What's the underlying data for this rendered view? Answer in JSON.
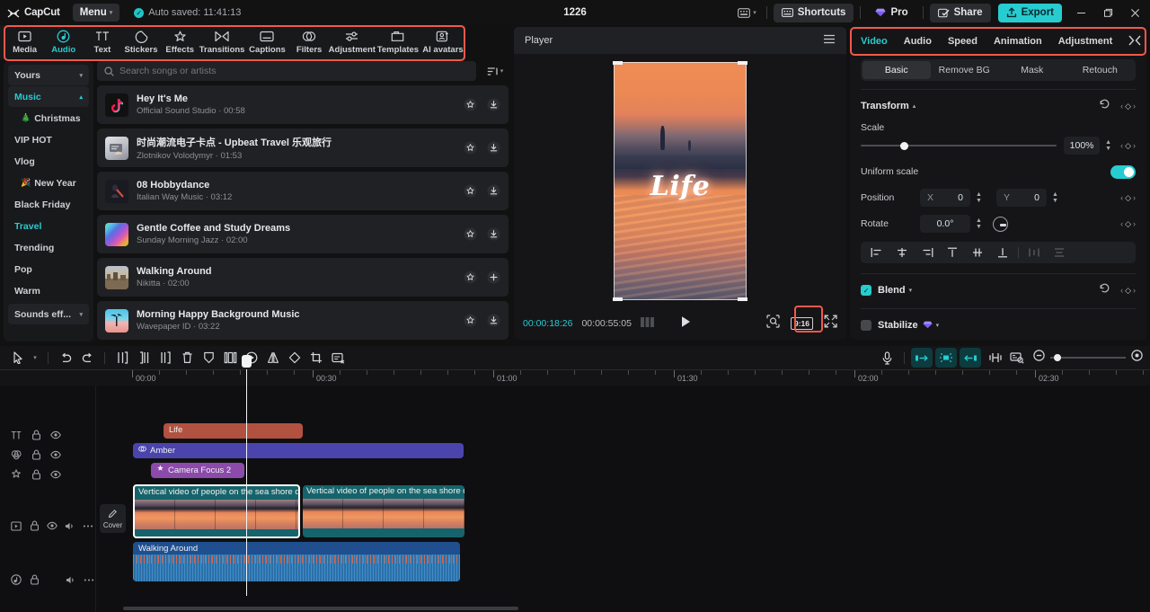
{
  "titlebar": {
    "brand": "CapCut",
    "menu_label": "Menu",
    "autosave_text": "Auto saved: 11:41:13",
    "project_title": "1226",
    "shortcuts_label": "Shortcuts",
    "pro_label": "Pro",
    "share_label": "Share",
    "export_label": "Export",
    "minimize": "–",
    "maximize": "❐",
    "close": "✕"
  },
  "tool_tabs": {
    "highlight_color": "#f2594b",
    "items": [
      {
        "label": "Media",
        "icon": "media-icon",
        "active": false
      },
      {
        "label": "Audio",
        "icon": "audio-icon",
        "active": true
      },
      {
        "label": "Text",
        "icon": "text-icon",
        "active": false
      },
      {
        "label": "Stickers",
        "icon": "stickers-icon",
        "active": false
      },
      {
        "label": "Effects",
        "icon": "effects-icon",
        "active": false
      },
      {
        "label": "Transitions",
        "icon": "transitions-icon",
        "active": false
      },
      {
        "label": "Captions",
        "icon": "captions-icon",
        "active": false
      },
      {
        "label": "Filters",
        "icon": "filters-icon",
        "active": false
      },
      {
        "label": "Adjustment",
        "icon": "adjustment-icon",
        "active": false
      },
      {
        "label": "Templates",
        "icon": "templates-icon",
        "active": false
      },
      {
        "label": "AI avatars",
        "icon": "ai-avatars-icon",
        "active": false
      }
    ]
  },
  "rail": {
    "items": [
      {
        "label": "Yours",
        "type": "group",
        "caret": "⌄"
      },
      {
        "label": "Music",
        "type": "group",
        "caret": "⌃",
        "selected": true
      },
      {
        "label": "Christmas",
        "emoji": "🎄"
      },
      {
        "label": "VIP HOT"
      },
      {
        "label": "Vlog"
      },
      {
        "label": "New Year",
        "emoji": "🎉"
      },
      {
        "label": "Black Friday"
      },
      {
        "label": "Travel",
        "accent": true
      },
      {
        "label": "Trending"
      },
      {
        "label": "Pop"
      },
      {
        "label": "Warm"
      },
      {
        "label": "Sounds eff...",
        "type": "group",
        "caret": "⌄"
      }
    ]
  },
  "search": {
    "placeholder": "Search songs or artists",
    "value": "",
    "icon": "search-icon",
    "filter_icon": "filter-sort-icon"
  },
  "songs": [
    {
      "title": "Hey It's Me",
      "artist": "Official Sound Studio",
      "duration": "00:58",
      "fav_icon": "star-icon",
      "action_icon": "download-icon",
      "cover": "tiktok"
    },
    {
      "title": "时尚潮流电子卡点 - Upbeat Travel 乐观旅行",
      "artist": "Zlotnikov Volodymyr",
      "duration": "01:53",
      "fav_icon": "star-icon",
      "action_icon": "download-icon",
      "cover": "photo1"
    },
    {
      "title": "08 Hobbydance",
      "artist": "Italian Way Music",
      "duration": "03:12",
      "fav_icon": "star-icon",
      "action_icon": "download-icon",
      "cover": "photo2"
    },
    {
      "title": "Gentle Coffee and Study Dreams",
      "artist": "Sunday Morning Jazz",
      "duration": "02:00",
      "fav_icon": "star-icon",
      "action_icon": "download-icon",
      "cover": "rainbow"
    },
    {
      "title": "Walking Around",
      "artist": "Nikitta",
      "duration": "02:00",
      "fav_icon": "star-icon",
      "action_icon": "plus-icon",
      "cover": "photo3"
    },
    {
      "title": "Morning Happy Background Music",
      "artist": "Wavepaper ID",
      "duration": "03:22",
      "fav_icon": "star-icon",
      "action_icon": "download-icon",
      "cover": "palm"
    }
  ],
  "player": {
    "title": "Player",
    "menu_icon": "hamburger-icon",
    "overlay_text": "Life",
    "current_time": "00:00:18:26",
    "total_time": "00:00:55:05",
    "play_icon": "play-icon",
    "frames_icon": "frames-icon",
    "magnify_icon": "magnifier-icon",
    "ratio_label": "9:16",
    "fullscreen_icon": "fullscreen-icon"
  },
  "inspector": {
    "tabs": [
      {
        "label": "Video",
        "active": true
      },
      {
        "label": "Audio",
        "active": false
      },
      {
        "label": "Speed",
        "active": false
      },
      {
        "label": "Animation",
        "active": false
      },
      {
        "label": "Adjustment",
        "active": false
      }
    ],
    "more_icon": "expand-panel-icon",
    "segments": [
      {
        "label": "Basic",
        "on": true
      },
      {
        "label": "Remove BG",
        "on": false
      },
      {
        "label": "Mask",
        "on": false
      },
      {
        "label": "Retouch",
        "on": false
      }
    ],
    "transform": {
      "title": "Transform",
      "reset_icon": "reset-icon",
      "keyframe_icon": "keyframe-diamond-icon",
      "scale_label": "Scale",
      "scale_value": "100%",
      "uniform_label": "Uniform scale",
      "uniform_on": true,
      "position_label": "Position",
      "position_x_axis": "X",
      "position_x": "0",
      "position_y_axis": "Y",
      "position_y": "0",
      "rotate_label": "Rotate",
      "rotate_value": "0.0°"
    },
    "blend": {
      "label": "Blend",
      "checked": true,
      "caret": "▾"
    },
    "stabilize": {
      "label": "Stabilize",
      "checked": false,
      "caret": "▾",
      "pro_icon": "pro-diamond-icon"
    }
  },
  "timeline_toolbar": {
    "left_tools": [
      {
        "icon": "select-arrow-icon",
        "name": "select-tool"
      },
      {
        "icon": "caret-down-icon",
        "name": "select-tool-dropdown"
      },
      {
        "icon": "undo-icon",
        "name": "undo-button"
      },
      {
        "icon": "redo-icon",
        "name": "redo-button"
      },
      {
        "icon": "split-icon",
        "name": "split-button"
      },
      {
        "icon": "trim-left-icon",
        "name": "trim-left-button"
      },
      {
        "icon": "trim-right-icon",
        "name": "trim-right-button"
      },
      {
        "icon": "delete-icon",
        "name": "delete-button"
      },
      {
        "icon": "freeze-icon",
        "name": "freeze-button"
      },
      {
        "icon": "mirror-frames-icon",
        "name": "reverse-button"
      },
      {
        "icon": "speed-icon",
        "name": "speed-button"
      },
      {
        "icon": "flip-icon",
        "name": "mirror-button"
      },
      {
        "icon": "rotate-icon",
        "name": "rotate-button"
      },
      {
        "icon": "crop-icon",
        "name": "crop-button"
      },
      {
        "icon": "caption-edit-icon",
        "name": "auto-caption-button"
      }
    ],
    "right_tools": [
      {
        "icon": "mic-icon",
        "name": "record-voiceover-button",
        "active": false
      },
      {
        "icon": "snap-left-icon",
        "name": "snap-left-button",
        "active": true
      },
      {
        "icon": "auto-snap-icon",
        "name": "auto-snap-button",
        "active": true
      },
      {
        "icon": "snap-right-icon",
        "name": "snap-right-button",
        "active": true
      },
      {
        "icon": "link-clips-icon",
        "name": "link-clips-button",
        "active": false
      },
      {
        "icon": "preview-zoom-icon",
        "name": "preview-render-button",
        "active": false
      }
    ],
    "zoom_out_icon": "zoom-out-icon",
    "zoom_in_icon": "zoom-in-icon"
  },
  "timeline": {
    "ruler_labels": [
      "00:00",
      "00:30",
      "01:00",
      "01:30",
      "02:00",
      "02:30"
    ],
    "playhead_time": "00:00:18:26",
    "cover_button_label": "Cover",
    "cover_button_icon": "pencil-icon",
    "tracks": [
      {
        "name": "text-track",
        "header_icon": "text-track-icon",
        "lock_icon": "lock-icon",
        "eye_icon": "eye-icon",
        "clips": [
          {
            "label": "Life",
            "color": "#b0523f",
            "icon": ""
          }
        ]
      },
      {
        "name": "audio-effect-track",
        "header_icon": "effects-track-icon",
        "lock_icon": "lock-icon",
        "eye_icon": "eye-icon",
        "clips": [
          {
            "label": "Amber",
            "color": "#4b44ad",
            "icon": "filter-glyph"
          }
        ]
      },
      {
        "name": "sticker-track",
        "header_icon": "sticker-track-icon",
        "lock_icon": "lock-icon",
        "eye_icon": "eye-icon",
        "clips": [
          {
            "label": "Camera Focus 2",
            "color": "#8c4aaa",
            "icon": "effect-glyph"
          }
        ]
      },
      {
        "name": "main-video-track",
        "header_icon": "video-track-icon",
        "lock_icon": "lock-icon",
        "eye_icon": "eye-icon",
        "volume_icon": "volume-icon",
        "more_icon": "more-icon",
        "clips": [
          {
            "label": "Vertical video of people on the sea shore du",
            "color": "#16646b",
            "selected": true
          },
          {
            "label": "Vertical video of people on the sea shore d",
            "color": "#16646b",
            "selected": false
          }
        ]
      },
      {
        "name": "music-track",
        "header_icon": "music-track-icon",
        "lock_icon": "lock-icon",
        "volume_icon": "volume-icon",
        "more_icon": "more-icon",
        "clips": [
          {
            "label": "Walking Around",
            "color": "#1f4f8f"
          }
        ]
      }
    ]
  }
}
